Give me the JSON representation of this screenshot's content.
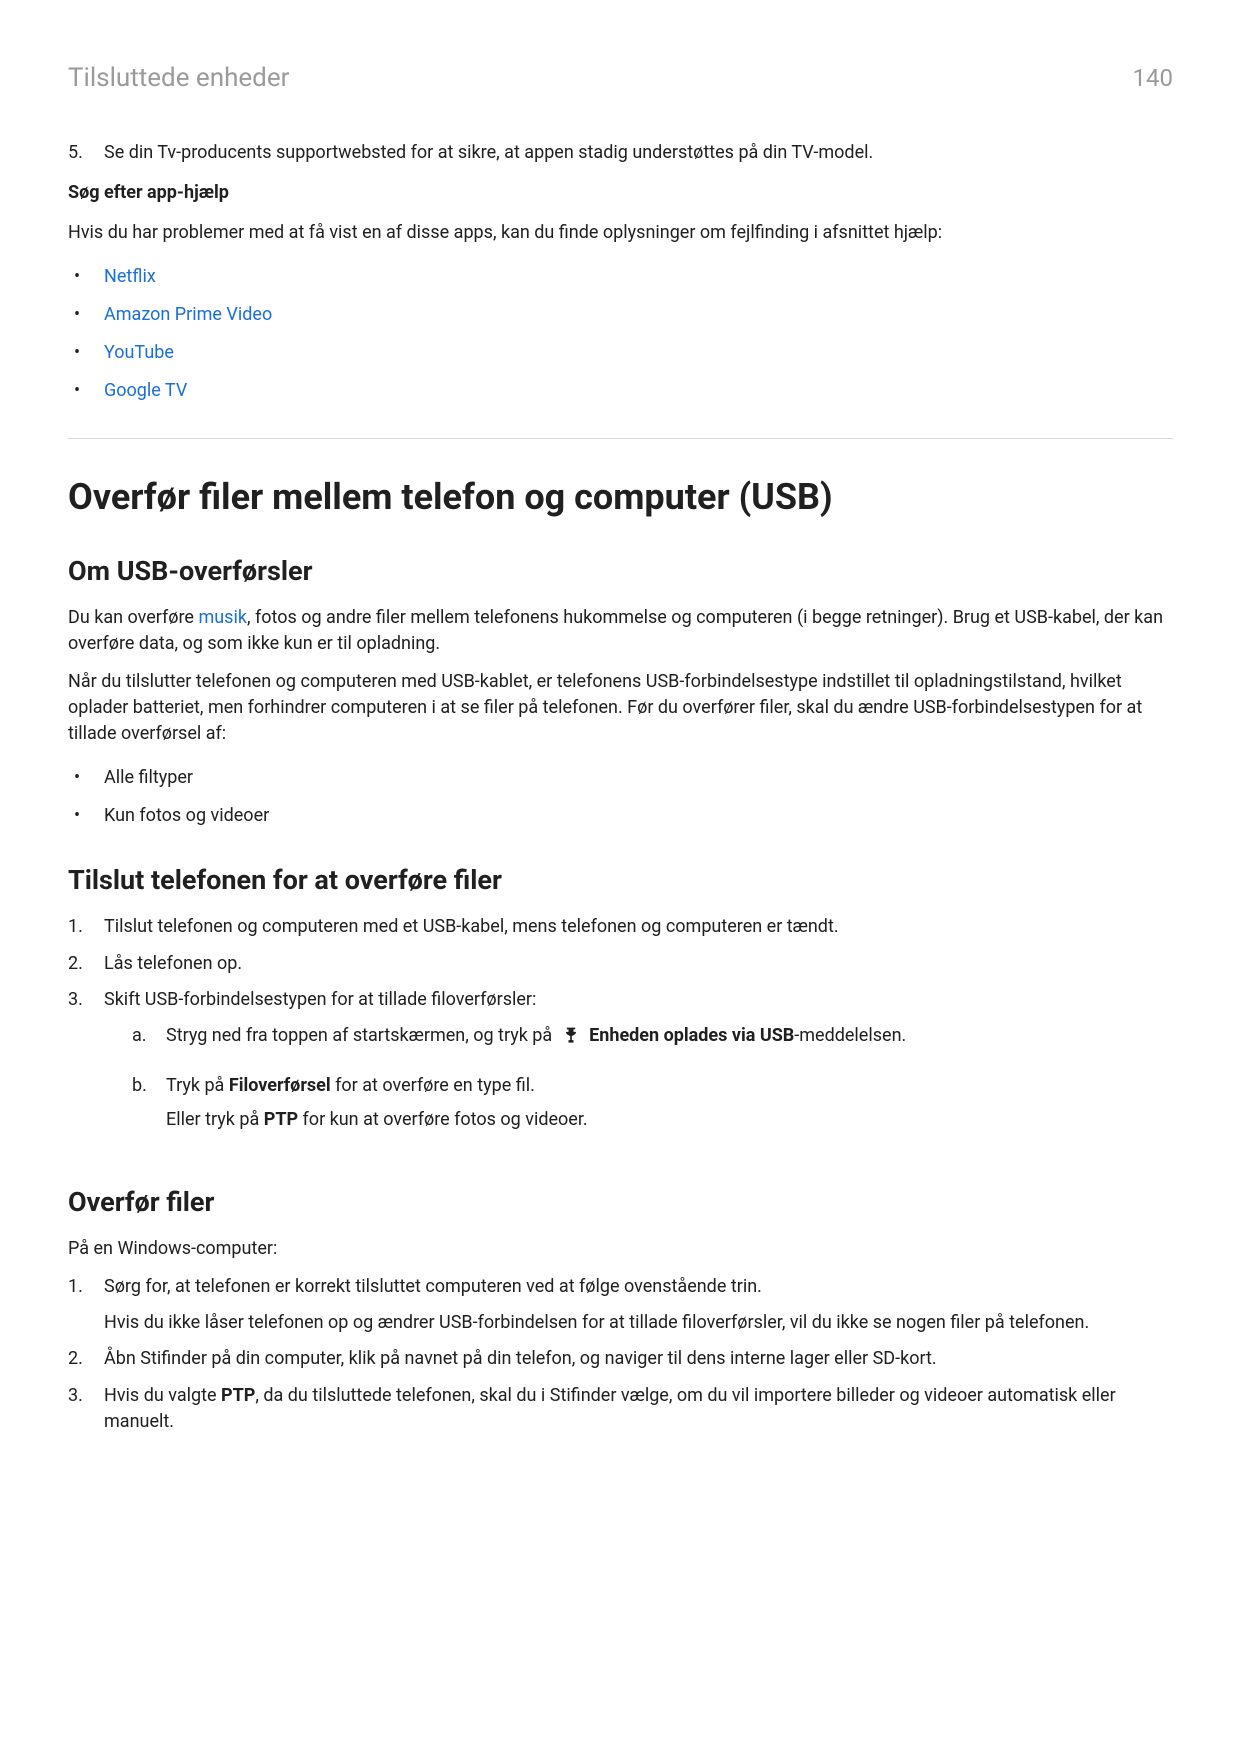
{
  "header": {
    "breadcrumb": "Tilsluttede enheder",
    "page_number": "140"
  },
  "intro_list": {
    "start": 5,
    "items": [
      "Se din Tv-producents supportwebsted for at sikre, at appen stadig understøttes på din TV-model."
    ]
  },
  "app_help": {
    "heading": "Søg efter app-hjælp",
    "intro": "Hvis du har problemer med at få vist en af disse apps, kan du finde oplysninger om fejlfinding i afsnittet hjælp:",
    "links": [
      "Netflix",
      "Amazon Prime Video",
      "YouTube",
      "Google TV"
    ]
  },
  "main_title": "Overfør filer mellem telefon og computer (USB)",
  "about": {
    "heading": "Om USB-overførsler",
    "p1_before": "Du kan overføre ",
    "p1_link": "musik",
    "p1_after": ", fotos og andre filer mellem telefonens hukommelse og computeren (i begge retninger). Brug et USB-kabel, der kan overføre data, og som ikke kun er til opladning.",
    "p2": "Når du tilslutter telefonen og computeren med USB-kablet, er telefonens USB-forbindelsestype indstillet til opladningstilstand, hvilket oplader batteriet, men forhindrer computeren i at se filer på telefonen. Før du overfører filer, skal du ændre USB-forbindelsestypen for at tillade overførsel af:",
    "bullets": [
      "Alle filtyper",
      "Kun fotos og videoer"
    ]
  },
  "connect": {
    "heading": "Tilslut telefonen for at overføre filer",
    "steps": [
      {
        "text": "Tilslut telefonen og computeren med et USB-kabel, mens telefonen og computeren er tændt."
      },
      {
        "text": "Lås telefonen op."
      },
      {
        "text": "Skift USB-forbindelsestypen for at tillade filoverførsler:",
        "sub": [
          {
            "letter": "a.",
            "seg_before": "Stryg ned fra toppen af startskærmen, og tryk på ",
            "icon": "usb-icon",
            "bold": "Enheden oplades via USB",
            "after": "-meddelelsen."
          },
          {
            "letter": "b.",
            "line1_before": "Tryk på ",
            "line1_bold": "Filoverførsel",
            "line1_after": " for at overføre en type fil.",
            "line2_before": "Eller tryk på ",
            "line2_bold": "PTP",
            "line2_after": " for kun at overføre fotos og videoer."
          }
        ]
      }
    ]
  },
  "transfer": {
    "heading": "Overfør filer",
    "intro": "På en Windows-computer:",
    "steps": [
      {
        "p1": "Sørg for, at telefonen er korrekt tilsluttet computeren ved at følge ovenstående trin.",
        "p2": "Hvis du ikke låser telefonen op og ændrer USB-forbindelsen for at tillade filoverførsler, vil du ikke se nogen filer på telefonen."
      },
      {
        "p1": "Åbn Stifinder på din computer, klik på navnet på din telefon, og naviger til dens interne lager eller SD-kort."
      },
      {
        "p1_before": "Hvis du valgte ",
        "p1_bold": "PTP",
        "p1_after": ", da du tilsluttede telefonen, skal du i Stifinder vælge, om du vil importere billeder og videoer automatisk eller manuelt."
      }
    ]
  }
}
